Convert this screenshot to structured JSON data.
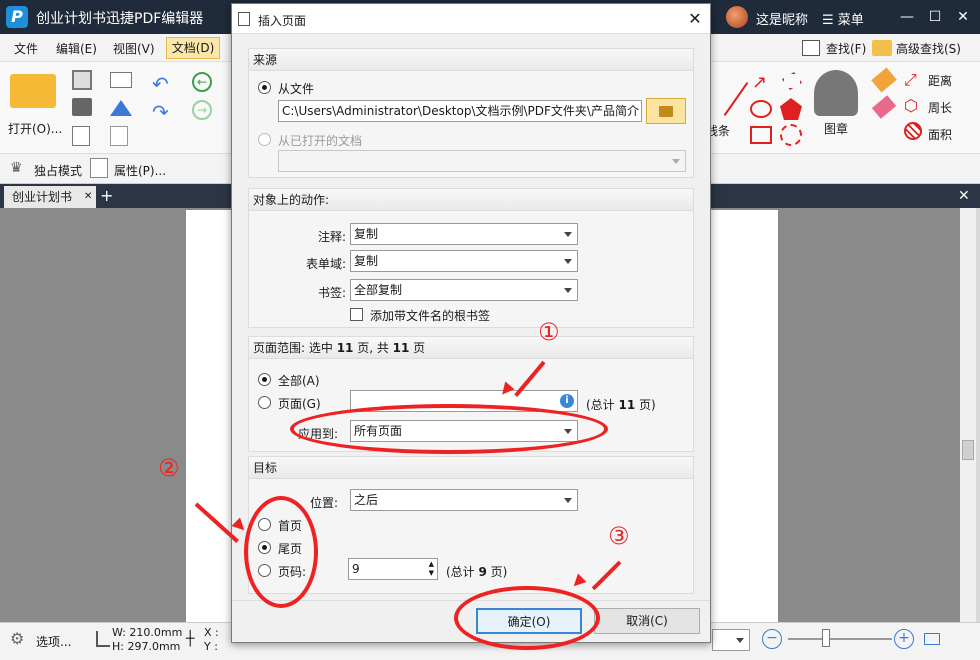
{
  "app": {
    "logo_letter": "P",
    "title": "创业计划书迅捷PDF编辑器",
    "nickname": "这是昵称",
    "menu": "☰ 菜单"
  },
  "menubar": {
    "file": "文件",
    "edit": "编辑(E)",
    "view": "视图(V)",
    "doc": "文档(D)",
    "find": "查找(F)",
    "advanced_find": "高级查找(S)"
  },
  "ribbon": {
    "open": "打开(O)...",
    "line": "线条",
    "stamp": "图章",
    "distance": "距离",
    "perimeter": "周长",
    "area": "面积"
  },
  "ribbon2": {
    "solo_mode": "独占模式",
    "properties": "属性(P)..."
  },
  "tabs": {
    "doc_tab": "创业计划书"
  },
  "statusbar": {
    "options": "选项...",
    "width": "W: 210.0mm",
    "height": "H: 297.0mm",
    "x": "X :",
    "y": "Y :"
  },
  "dialog": {
    "title": "插入页面",
    "source": {
      "header": "来源",
      "from_file": "从文件",
      "file_path": "C:\\Users\\Administrator\\Desktop\\文档示例\\PDF文件夹\\产品简介",
      "from_open_doc": "从已打开的文档"
    },
    "actions": {
      "header": "对象上的动作:",
      "annotation_label": "注释:",
      "annotation_value": "复制",
      "formfield_label": "表单域:",
      "formfield_value": "复制",
      "bookmark_label": "书签:",
      "bookmark_value": "全部复制",
      "root_bookmark": "添加带文件名的根书签"
    },
    "range": {
      "header_prefix": "页面范围: 选中 ",
      "selected": "11",
      "header_mid": " 页, 共 ",
      "total": "11",
      "header_suffix": " 页",
      "all": "全部(A)",
      "pages": "页面(G)",
      "pages_total_prefix": "(总计 ",
      "pages_total": "11",
      "pages_total_suffix": " 页)",
      "apply_label": "应用到:",
      "apply_value": "所有页面"
    },
    "target": {
      "header": "目标",
      "position_label": "位置:",
      "position_value": "之后",
      "first": "首页",
      "last": "尾页",
      "page_num": "页码:",
      "page_value": "9",
      "total_prefix": "(总计 ",
      "total": "9",
      "total_suffix": " 页)"
    },
    "ok": "确定(O)",
    "cancel": "取消(C)"
  },
  "annotations": {
    "n1": "①",
    "n2": "②",
    "n3": "③"
  },
  "colors": {
    "annotation_red": "#ee2222",
    "titlebar": "#1f2a3a",
    "accent_yellow": "#fbe7a8"
  }
}
